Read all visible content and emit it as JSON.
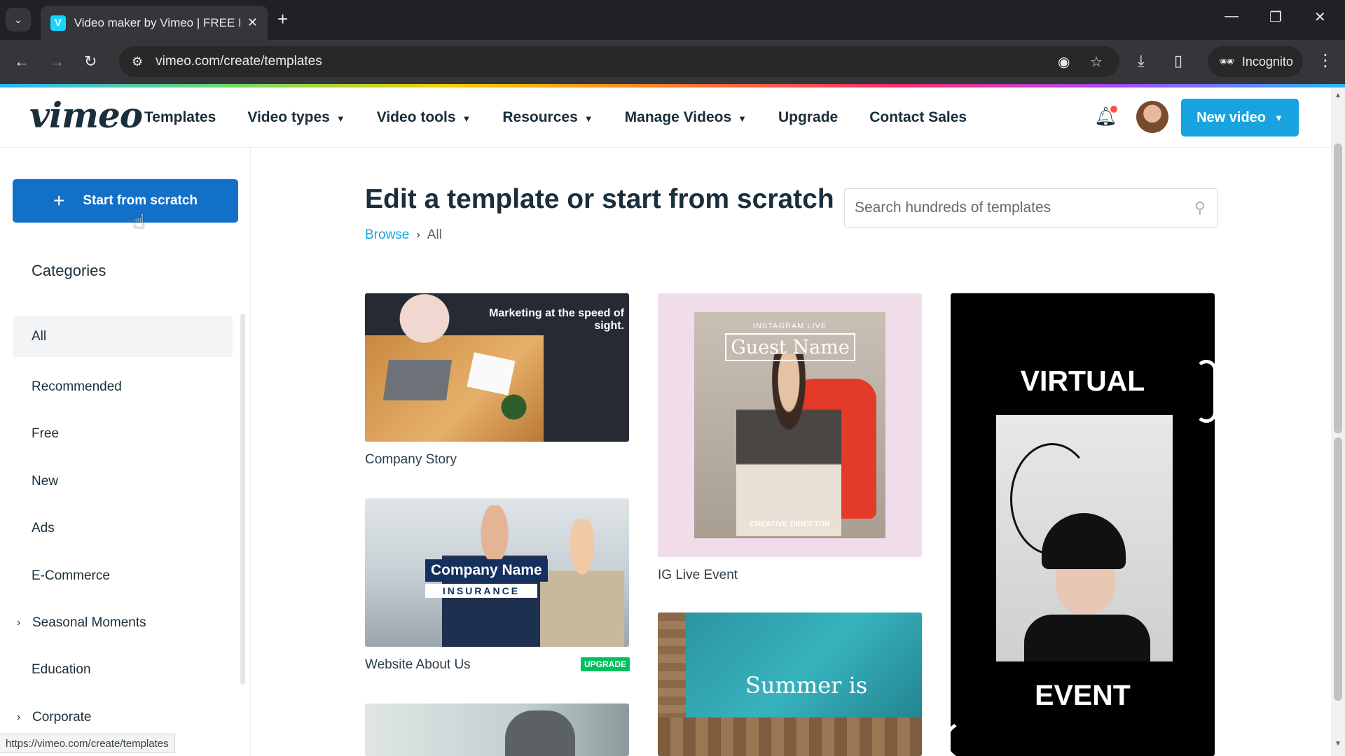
{
  "browser": {
    "tab_title": "Video maker by Vimeo | FREE M",
    "url": "vimeo.com/create/templates",
    "incognito_label": "Incognito",
    "status_url": "https://vimeo.com/create/templates"
  },
  "header": {
    "logo": "vimeo",
    "nav": [
      {
        "label": "Templates",
        "has_dropdown": false
      },
      {
        "label": "Video types",
        "has_dropdown": true
      },
      {
        "label": "Video tools",
        "has_dropdown": true
      },
      {
        "label": "Resources",
        "has_dropdown": true
      },
      {
        "label": "Manage Videos",
        "has_dropdown": true
      },
      {
        "label": "Upgrade",
        "has_dropdown": false
      },
      {
        "label": "Contact Sales",
        "has_dropdown": false
      }
    ],
    "new_video_label": "New video"
  },
  "sidebar": {
    "start_label": "Start from scratch",
    "categories_title": "Categories",
    "categories": [
      {
        "label": "All",
        "active": true,
        "expandable": false
      },
      {
        "label": "Recommended",
        "active": false,
        "expandable": false
      },
      {
        "label": "Free",
        "active": false,
        "expandable": false
      },
      {
        "label": "New",
        "active": false,
        "expandable": false
      },
      {
        "label": "Ads",
        "active": false,
        "expandable": false
      },
      {
        "label": "E-Commerce",
        "active": false,
        "expandable": false
      },
      {
        "label": "Seasonal Moments",
        "active": false,
        "expandable": true
      },
      {
        "label": "Education",
        "active": false,
        "expandable": false
      },
      {
        "label": "Corporate",
        "active": false,
        "expandable": true
      }
    ]
  },
  "main": {
    "title": "Edit a template or start from scratch",
    "search_placeholder": "Search hundreds of templates",
    "breadcrumb": {
      "link": "Browse",
      "current": "All"
    },
    "templates": {
      "company_story": {
        "label": "Company Story",
        "overlay": "Marketing at the speed of sight."
      },
      "website_about_us": {
        "label": "Website About Us",
        "badge": "UPGRADE",
        "overlay_name": "Company Name",
        "overlay_sub": "INSURANCE"
      },
      "ig_live_event": {
        "label": "IG Live Event",
        "overlay_top": "INSTAGRAM LIVE",
        "overlay_name": "Guest Name",
        "overlay_role": "CREATIVE DIRECTOR"
      },
      "summer": {
        "overlay": "Summer is"
      },
      "virtual_event": {
        "overlay_top": "VIRTUAL",
        "overlay_bottom": "EVENT"
      }
    }
  },
  "colors": {
    "brand_blue": "#17a3e0",
    "primary_button": "#1270c8",
    "upgrade_badge": "#00c060",
    "text_dark": "#1a2e3b"
  }
}
